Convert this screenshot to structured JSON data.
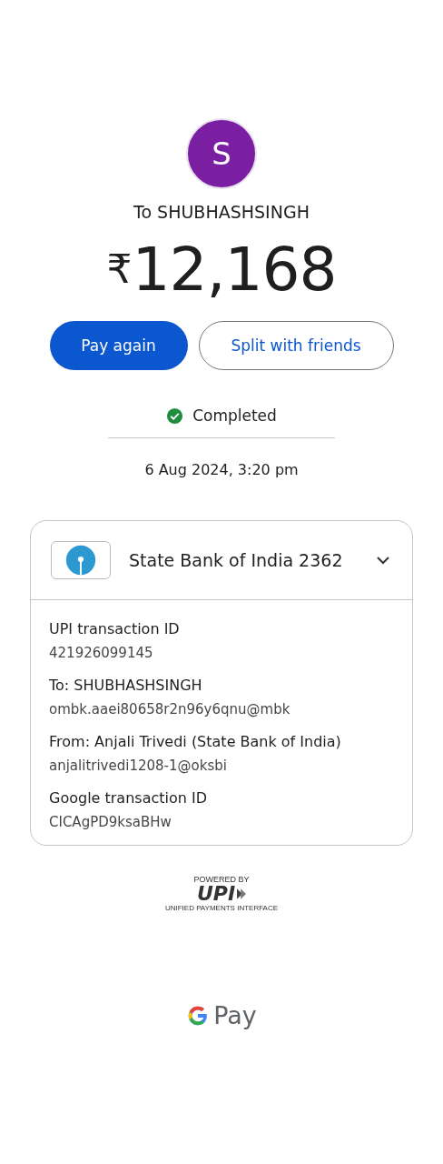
{
  "payee": {
    "initial": "S",
    "label": "To SHUBHASHSINGH"
  },
  "amount": {
    "currency": "₹",
    "value": "12,168"
  },
  "actions": [
    {
      "label": "Pay again",
      "kind": "primary"
    },
    {
      "label": "Split with friends",
      "kind": "outlined"
    }
  ],
  "status": {
    "kind": "completed",
    "label": "Completed"
  },
  "date": "6 Aug 2024, 3:20 pm",
  "account": {
    "bank": "State Bank of India 2362"
  },
  "details": [
    {
      "label": "UPI transaction ID",
      "value": "421926099145"
    },
    {
      "label": "To: SHUBHASHSINGH",
      "value": "ombk.aaei80658r2n96y6qnu@mbk"
    },
    {
      "label": "From: Anjali  Trivedi (State Bank of India)",
      "value": "anjalitrivedi1208-1@oksbi"
    },
    {
      "label": "Google transaction ID",
      "value": "CICAgPD9ksaBHw"
    }
  ],
  "footer": {
    "powered_by": "POWERED BY",
    "upi": "UPI",
    "upi_tagline": "UNIFIED PAYMENTS INTERFACE",
    "brand": "Pay"
  }
}
